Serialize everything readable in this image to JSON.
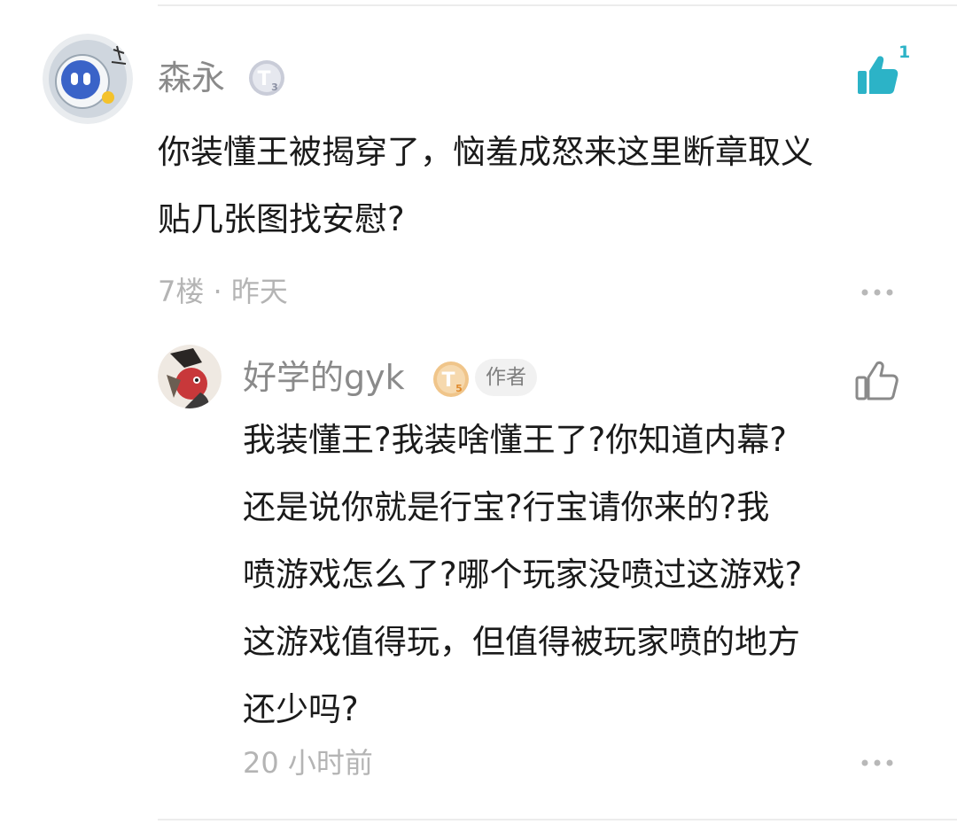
{
  "comment": {
    "author": "森永",
    "level_badge_icon": "level-t3-badge-icon",
    "like_count": "1",
    "like_color": "#2cb3c7",
    "content_lines": [
      "你装懂王被揭穿了，恼羞成怒来这里断章取义",
      "贴几张图找安慰?"
    ],
    "floor": "7楼",
    "separator": "·",
    "time": "昨天",
    "more_icon": "more-dots-icon"
  },
  "reply": {
    "author": "好学的gyk",
    "level_badge_icon": "level-t5-badge-icon",
    "author_tag": "作者",
    "content_lines": [
      "我装懂王?我装啥懂王了?你知道内幕?",
      "还是说你就是行宝?行宝请你来的?我",
      "喷游戏怎么了?哪个玩家没喷过这游戏?",
      "这游戏值得玩，但值得被玩家喷的地方",
      "还少吗?"
    ],
    "time": "20 小时前",
    "more_icon": "more-dots-icon"
  }
}
